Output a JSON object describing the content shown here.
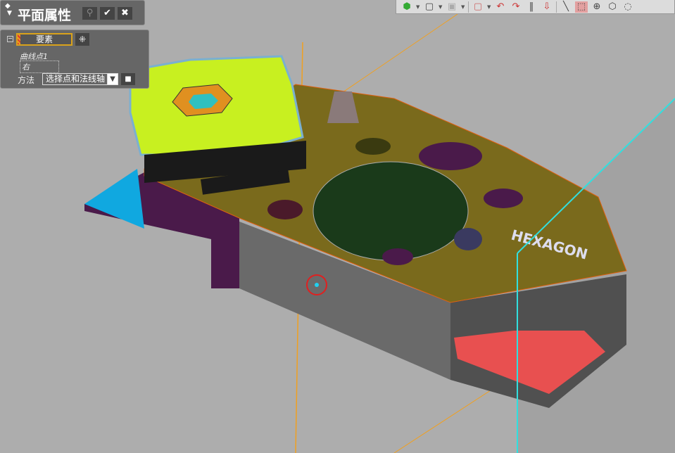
{
  "panel": {
    "title": "平面属性",
    "pin_icon": "pin-icon",
    "search_icon": "search-icon",
    "ok_icon": "check-icon",
    "close_icon": "close-icon"
  },
  "properties": {
    "collapse": "−",
    "element_label": "要素",
    "items": [
      "曲线点1",
      "右"
    ],
    "method_label": "方法",
    "method_value": "选择点和法线轴",
    "dropdown": "▼",
    "lock": "🔒",
    "star": "⁜"
  },
  "toolbar": {
    "icons": [
      "view-solid-icon",
      "view-cube-icon",
      "view-shaded-icon",
      "section-box-icon",
      "rotate-left-icon",
      "rotate-right-icon",
      "parallel-icon",
      "push-icon",
      "line-icon",
      "dotted-box-icon",
      "circle-plus-icon",
      "hexagon-plus-icon",
      "free-shape-icon"
    ]
  },
  "model": {
    "logo_text": "HEXAGON"
  },
  "colors": {
    "background": "#adadad",
    "part_top": "#7a6a1c",
    "part_side": "#6b6b6b",
    "lime": "#c8f020",
    "cyan_plane": "#30d0e0",
    "orange_line": "#f0a020"
  }
}
